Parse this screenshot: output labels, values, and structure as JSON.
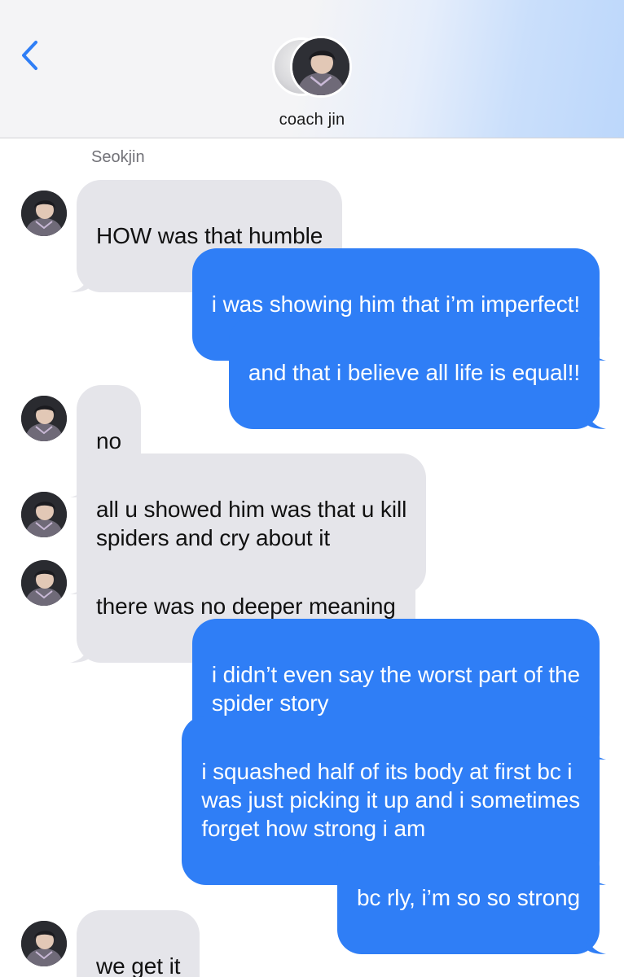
{
  "header": {
    "contact_name": "coach jin",
    "back_icon": "chevron-left-icon",
    "accent_color": "#2f7ef6"
  },
  "sender_label": "Seokjin",
  "messages": [
    {
      "direction": "incoming",
      "text": "HOW was that humble"
    },
    {
      "direction": "outgoing",
      "text": "i was showing him that i’m imperfect!"
    },
    {
      "direction": "outgoing",
      "text": "and that i believe all life is equal!!"
    },
    {
      "direction": "incoming",
      "text": "no"
    },
    {
      "direction": "incoming",
      "text": "all u showed him was that u kill\nspiders and cry about it"
    },
    {
      "direction": "incoming",
      "text": "there was no deeper meaning"
    },
    {
      "direction": "outgoing",
      "text": "i didn’t even say the worst part of the\nspider story"
    },
    {
      "direction": "outgoing",
      "text": "i squashed half of its body at first bc i\nwas just picking it up and i sometimes\nforget how strong i am"
    },
    {
      "direction": "outgoing",
      "text": "bc rly, i’m so so strong"
    },
    {
      "direction": "incoming",
      "text": "we get it"
    }
  ],
  "colors": {
    "incoming_bubble": "#e5e5ea",
    "outgoing_bubble": "#2f7ef6",
    "sender_label": "#727278"
  }
}
